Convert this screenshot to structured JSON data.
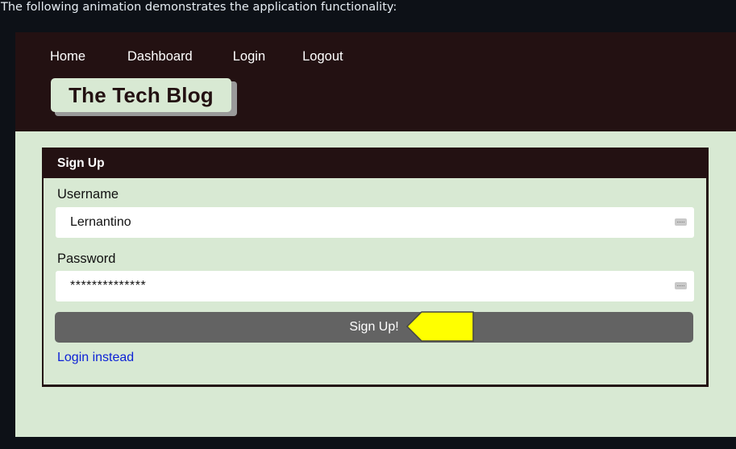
{
  "caption": "The following animation demonstrates the application functionality:",
  "nav": {
    "items": [
      "Home",
      "Dashboard",
      "Login",
      "Logout"
    ]
  },
  "brand": {
    "title": "The Tech Blog"
  },
  "signup_card": {
    "header": "Sign Up",
    "username_label": "Username",
    "username_value": "Lernantino",
    "password_label": "Password",
    "password_value": "**************",
    "submit_label": "Sign Up!",
    "login_link": "Login instead"
  },
  "colors": {
    "header_bg": "#231112",
    "page_bg": "#d8e9d3",
    "button_bg": "#636363",
    "link": "#0d22d6",
    "pointer_fill": "#ffff00"
  },
  "icons": {
    "input_key": "password-manager-key-icon",
    "pointer": "yellow-pointer-arrow-icon"
  }
}
